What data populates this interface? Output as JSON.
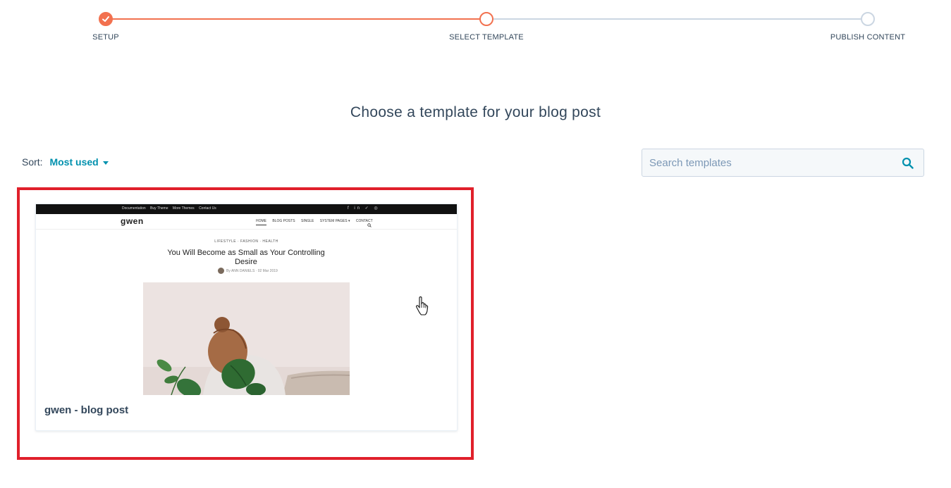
{
  "stepper": {
    "steps": [
      {
        "label": "SETUP",
        "state": "done"
      },
      {
        "label": "SELECT TEMPLATE",
        "state": "active"
      },
      {
        "label": "PUBLISH CONTENT",
        "state": "todo"
      }
    ]
  },
  "page": {
    "title": "Choose a template for your blog post"
  },
  "sort": {
    "label": "Sort:",
    "value": "Most used"
  },
  "search": {
    "placeholder": "Search templates"
  },
  "templates": [
    {
      "name": "gwen - blog post",
      "preview": {
        "top_links": [
          "Documentation",
          "Buy Theme",
          "More Themes",
          "Contact Us"
        ],
        "logo": "gwen",
        "menu": [
          "HOME",
          "BLOG POSTS",
          "SINGLE",
          "SYSTEM PAGES ▾",
          "CONTACT"
        ],
        "categories": "LIFESTYLE · FASHION · HEALTH",
        "post_title": "You Will Become as Small as Your Controlling Desire",
        "byline": "By ANN DANIELS · 02 Mar 2019"
      }
    }
  ],
  "colors": {
    "accent": "#f2714f",
    "link": "#0091ae",
    "text": "#33475b",
    "inactive": "#cbd6e2",
    "highlight": "#e0202b"
  }
}
